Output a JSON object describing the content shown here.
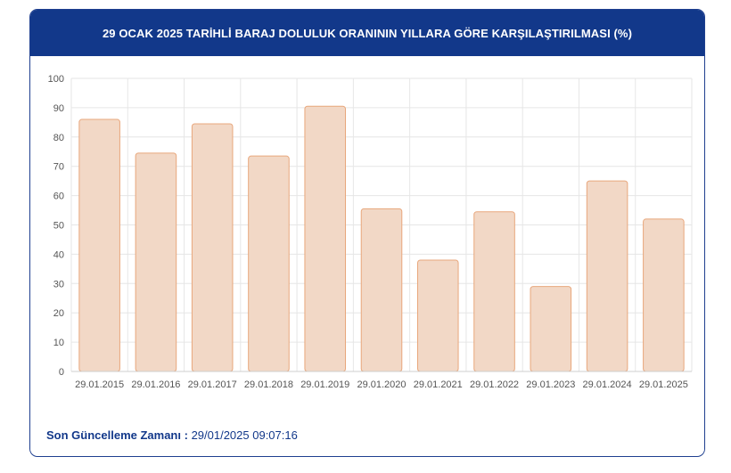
{
  "header": {
    "title": "29 OCAK 2025 TARİHLİ BARAJ DOLULUK ORANININ YILLARA GÖRE KARŞILAŞTIRILMASI (%)"
  },
  "footer": {
    "label": "Son Güncelleme Zamanı :",
    "value": "29/01/2025 09:07:16"
  },
  "colors": {
    "header_bg": "#12388a",
    "bar_fill": "#f2d8c6",
    "bar_stroke": "#e8a77c",
    "grid": "#e6e6e6"
  },
  "chart_data": {
    "type": "bar",
    "title": "29 OCAK 2025 TARİHLİ BARAJ DOLULUK ORANININ YILLARA GÖRE KARŞILAŞTIRILMASI (%)",
    "categories": [
      "29.01.2015",
      "29.01.2016",
      "29.01.2017",
      "29.01.2018",
      "29.01.2019",
      "29.01.2020",
      "29.01.2021",
      "29.01.2022",
      "29.01.2023",
      "29.01.2024",
      "29.01.2025"
    ],
    "values": [
      86.0,
      74.5,
      84.5,
      73.5,
      90.5,
      55.5,
      38.0,
      54.5,
      29.0,
      65.0,
      52.0
    ],
    "ylim": [
      0,
      100
    ],
    "yticks": [
      0,
      10,
      20,
      30,
      40,
      50,
      60,
      70,
      80,
      90,
      100
    ],
    "grid": true,
    "legend": false
  }
}
